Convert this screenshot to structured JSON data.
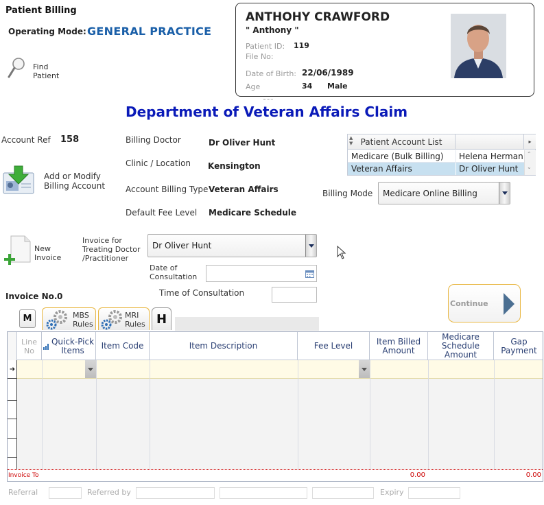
{
  "header": {
    "title": "Patient Billing",
    "mode_label": "Operating Mode:",
    "mode_value": "GENERAL PRACTICE",
    "find_patient_label_1": "Find",
    "find_patient_label_2": "Patient"
  },
  "patient": {
    "name": "ANTHOHY CRAWFORD",
    "nickname": "\" Anthony \"",
    "id_label": "Patient ID:",
    "id_value": "119",
    "file_label": "File No:",
    "dob_label": "Date of Birth:",
    "dob_value": "22/06/1989",
    "age_label": "Age",
    "age_value": "34",
    "sex_value": "Male"
  },
  "department_title": "Department of Veteran Affairs Claim",
  "account": {
    "ref_label": "Account Ref",
    "ref_value": "158",
    "add_modify_1": "Add or Modify",
    "add_modify_2": "Billing Account",
    "billing_doctor_label": "Billing Doctor",
    "billing_doctor_value": "Dr Oliver Hunt",
    "clinic_label": "Clinic / Location",
    "clinic_value": "Kensington",
    "billing_type_label": "Account Billing Type",
    "billing_type_value": "Veteran Affairs",
    "fee_level_label": "Default Fee Level",
    "fee_level_value": "Medicare Schedule"
  },
  "account_list": {
    "header": "Patient Account List",
    "rows": [
      {
        "type": "Medicare (Bulk Billing)",
        "doctor": "Helena Herman"
      },
      {
        "type": "Veteran Affairs",
        "doctor": "Dr Oliver Hunt"
      }
    ]
  },
  "billing_mode": {
    "label": "Billing Mode",
    "value": "Medicare Online Billing"
  },
  "invoice": {
    "new_1": "New",
    "new_2": "Invoice",
    "for_1": "Invoice for",
    "for_2": "Treating Doctor",
    "for_3": "/Practitioner",
    "doctor_value": "Dr Oliver Hunt",
    "date_label_1": "Date of",
    "date_label_2": "Consultation",
    "time_label": "Time of Consultation",
    "number_label": "Invoice No.",
    "number_value": "0",
    "continue_label": "Continue"
  },
  "tabs": {
    "m": "M",
    "mbs_1": "MBS",
    "mbs_2": "Rules",
    "mri_1": "MRI",
    "mri_2": "Rules",
    "h": "H"
  },
  "grid": {
    "col_line_1": "Line",
    "col_line_2": "No",
    "col_quick_1": "Quick-Pick",
    "col_quick_2": "Items",
    "col_item_code": "Item Code",
    "col_desc": "Item Description",
    "col_fee": "Fee Level",
    "col_billed_1": "Item Billed",
    "col_billed_2": "Amount",
    "col_sched_1": "Medicare",
    "col_sched_2": "Schedule",
    "col_sched_3": "Amount",
    "col_gap_1": "Gap",
    "col_gap_2": "Payment",
    "total_label": "Invoice To",
    "total_billed": "0.00",
    "total_gap": "0.00"
  },
  "footer": {
    "referral": "Referral",
    "referred_by": "Referred by",
    "expiry": "Expiry"
  },
  "colors": {
    "accent_blue": "#1a5fa8",
    "dept_blue": "#0a1ab8",
    "grid_header_text": "#2a3f73",
    "total_red": "#cc0000",
    "continue_border": "#e8b640"
  }
}
